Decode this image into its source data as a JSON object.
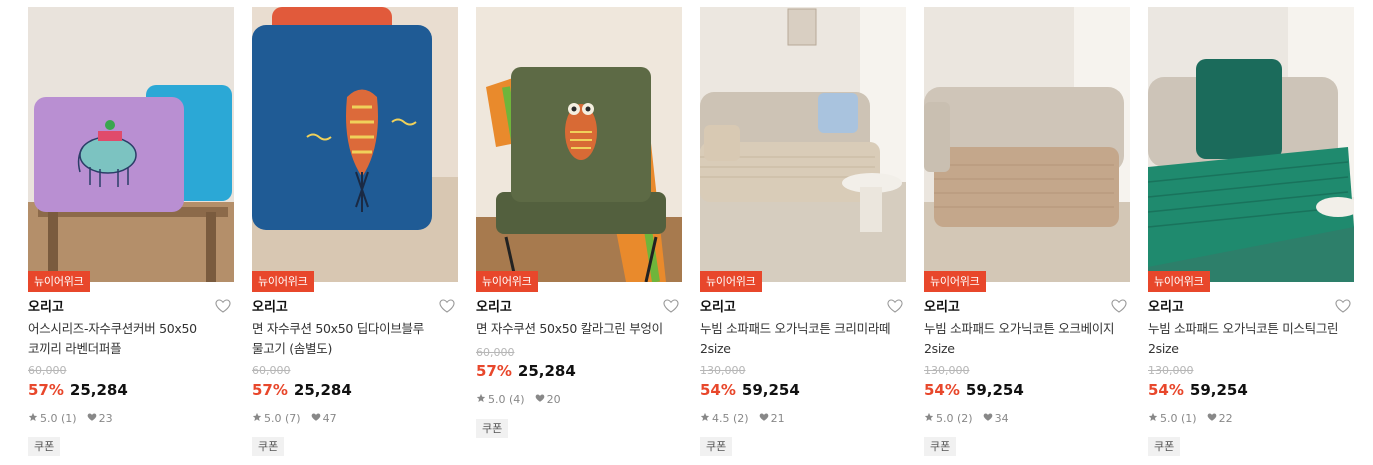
{
  "colors": {
    "accent": "#e8472b",
    "badge_bg": "#e8472b"
  },
  "products": [
    {
      "badge": "뉴이어위크",
      "brand": "오리고",
      "title": "어스시리즈-자수쿠션커버 50x50 코끼리 라벤더퍼플",
      "original_price": "60,000",
      "discount": "57%",
      "price": "25,284",
      "rating": "5.0 (1)",
      "likes": "23",
      "coupon": "쿠폰"
    },
    {
      "badge": "뉴이어위크",
      "brand": "오리고",
      "title": "면 자수쿠션 50x50 딥다이브블루 물고기 (솜별도)",
      "original_price": "60,000",
      "discount": "57%",
      "price": "25,284",
      "rating": "5.0 (7)",
      "likes": "47",
      "coupon": "쿠폰"
    },
    {
      "badge": "뉴이어위크",
      "brand": "오리고",
      "title": "면 자수쿠션 50x50 칼라그린 부엉이",
      "original_price": "60,000",
      "discount": "57%",
      "price": "25,284",
      "rating": "5.0 (4)",
      "likes": "20",
      "coupon": "쿠폰"
    },
    {
      "badge": "뉴이어위크",
      "brand": "오리고",
      "title": "누빔 소파패드 오가닉코튼 크리미라떼 2size",
      "original_price": "130,000",
      "discount": "54%",
      "price": "59,254",
      "rating": "4.5 (2)",
      "likes": "21",
      "coupon": "쿠폰"
    },
    {
      "badge": "뉴이어위크",
      "brand": "오리고",
      "title": "누빔 소파패드 오가닉코튼 오크베이지 2size",
      "original_price": "130,000",
      "discount": "54%",
      "price": "59,254",
      "rating": "5.0 (2)",
      "likes": "34",
      "coupon": "쿠폰"
    },
    {
      "badge": "뉴이어위크",
      "brand": "오리고",
      "title": "누빔 소파패드 오가닉코튼 미스틱그린 2size",
      "original_price": "130,000",
      "discount": "54%",
      "price": "59,254",
      "rating": "5.0 (1)",
      "likes": "22",
      "coupon": "쿠폰"
    }
  ]
}
